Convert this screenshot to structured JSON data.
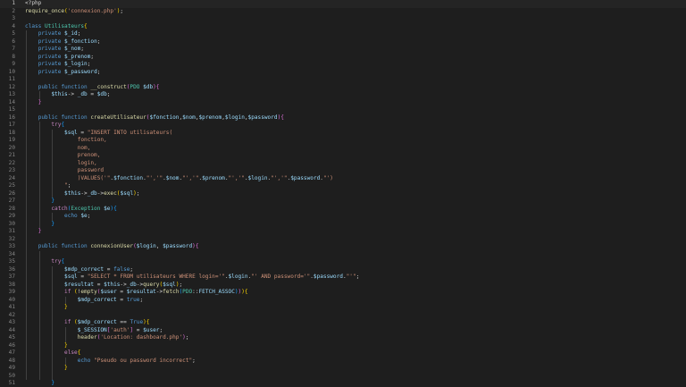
{
  "editor": {
    "lines": [
      {
        "n": "1",
        "tokens": [
          [
            "o",
            "<?php"
          ]
        ]
      },
      {
        "n": "2",
        "tokens": [
          [
            "f",
            "require_once"
          ],
          [
            "y",
            "("
          ],
          [
            "s",
            "'connexion.php'"
          ],
          [
            "y",
            ")"
          ],
          [
            "o",
            ";"
          ]
        ]
      },
      {
        "n": "3",
        "tokens": []
      },
      {
        "n": "4",
        "tokens": [
          [
            "k",
            "class "
          ],
          [
            "t",
            "Utilisateurs"
          ],
          [
            "y",
            "{"
          ]
        ]
      },
      {
        "n": "5",
        "tokens": [
          [
            "o",
            "    "
          ],
          [
            "k",
            "private "
          ],
          [
            "v",
            "$_id"
          ],
          [
            "o",
            ";"
          ]
        ]
      },
      {
        "n": "6",
        "tokens": [
          [
            "o",
            "    "
          ],
          [
            "k",
            "private "
          ],
          [
            "v",
            "$_fonction"
          ],
          [
            "o",
            ";"
          ]
        ]
      },
      {
        "n": "7",
        "tokens": [
          [
            "o",
            "    "
          ],
          [
            "k",
            "private "
          ],
          [
            "v",
            "$_nom"
          ],
          [
            "o",
            ";"
          ]
        ]
      },
      {
        "n": "8",
        "tokens": [
          [
            "o",
            "    "
          ],
          [
            "k",
            "private "
          ],
          [
            "v",
            "$_prenom"
          ],
          [
            "o",
            ";"
          ]
        ]
      },
      {
        "n": "9",
        "tokens": [
          [
            "o",
            "    "
          ],
          [
            "k",
            "private "
          ],
          [
            "v",
            "$_login"
          ],
          [
            "o",
            ";"
          ]
        ]
      },
      {
        "n": "10",
        "tokens": [
          [
            "o",
            "    "
          ],
          [
            "k",
            "private "
          ],
          [
            "v",
            "$_password"
          ],
          [
            "o",
            ";"
          ]
        ]
      },
      {
        "n": "11",
        "tokens": []
      },
      {
        "n": "12",
        "tokens": [
          [
            "o",
            "    "
          ],
          [
            "k",
            "public function "
          ],
          [
            "f",
            "__construct"
          ],
          [
            "p",
            "("
          ],
          [
            "t",
            "PDO "
          ],
          [
            "v",
            "$db"
          ],
          [
            "p",
            ")"
          ],
          [
            "p",
            "{"
          ]
        ]
      },
      {
        "n": "13",
        "tokens": [
          [
            "o",
            "        "
          ],
          [
            "v",
            "$this"
          ],
          [
            "o",
            "-> "
          ],
          [
            "v",
            "_db"
          ],
          [
            "o",
            " = "
          ],
          [
            "v",
            "$db"
          ],
          [
            "o",
            ";"
          ]
        ]
      },
      {
        "n": "14",
        "tokens": [
          [
            "o",
            "    "
          ],
          [
            "p",
            "}"
          ]
        ]
      },
      {
        "n": "15",
        "tokens": []
      },
      {
        "n": "16",
        "tokens": [
          [
            "o",
            "    "
          ],
          [
            "k",
            "public function "
          ],
          [
            "f",
            "createUtilisateur"
          ],
          [
            "p",
            "("
          ],
          [
            "v",
            "$fonction"
          ],
          [
            "o",
            ","
          ],
          [
            "v",
            "$nom"
          ],
          [
            "o",
            ","
          ],
          [
            "v",
            "$prenom"
          ],
          [
            "o",
            ","
          ],
          [
            "v",
            "$login"
          ],
          [
            "o",
            ","
          ],
          [
            "v",
            "$password"
          ],
          [
            "p",
            ")"
          ],
          [
            "p",
            "{"
          ]
        ]
      },
      {
        "n": "17",
        "tokens": [
          [
            "o",
            "        "
          ],
          [
            "c",
            "try"
          ],
          [
            "b",
            "{"
          ]
        ]
      },
      {
        "n": "18",
        "tokens": [
          [
            "o",
            "            "
          ],
          [
            "v",
            "$sql"
          ],
          [
            "o",
            " = "
          ],
          [
            "s",
            "\"INSERT INTO utilisateurs("
          ]
        ]
      },
      {
        "n": "19",
        "tokens": [
          [
            "s",
            "                fonction,"
          ]
        ]
      },
      {
        "n": "20",
        "tokens": [
          [
            "s",
            "                nom,"
          ]
        ]
      },
      {
        "n": "21",
        "tokens": [
          [
            "s",
            "                prenom,"
          ]
        ]
      },
      {
        "n": "22",
        "tokens": [
          [
            "s",
            "                login,"
          ]
        ]
      },
      {
        "n": "23",
        "tokens": [
          [
            "s",
            "                password"
          ]
        ]
      },
      {
        "n": "24",
        "tokens": [
          [
            "s",
            "                )VALUES('\""
          ],
          [
            "o",
            "."
          ],
          [
            "v",
            "$fonction"
          ],
          [
            "o",
            "."
          ],
          [
            "s",
            "\"','\""
          ],
          [
            "o",
            "."
          ],
          [
            "v",
            "$nom"
          ],
          [
            "o",
            "."
          ],
          [
            "s",
            "\"','\""
          ],
          [
            "o",
            "."
          ],
          [
            "v",
            "$prenom"
          ],
          [
            "o",
            "."
          ],
          [
            "s",
            "\"','\""
          ],
          [
            "o",
            "."
          ],
          [
            "v",
            "$login"
          ],
          [
            "o",
            "."
          ],
          [
            "s",
            "\"','\""
          ],
          [
            "o",
            "."
          ],
          [
            "v",
            "$password"
          ],
          [
            "o",
            "."
          ],
          [
            "s",
            "\"')"
          ]
        ]
      },
      {
        "n": "25",
        "tokens": [
          [
            "s",
            "            \""
          ],
          [
            "o",
            ";"
          ]
        ]
      },
      {
        "n": "26",
        "tokens": [
          [
            "o",
            "            "
          ],
          [
            "v",
            "$this"
          ],
          [
            "o",
            "->"
          ],
          [
            "v",
            "_db"
          ],
          [
            "o",
            "->"
          ],
          [
            "f",
            "exec"
          ],
          [
            "y",
            "("
          ],
          [
            "v",
            "$sql"
          ],
          [
            "y",
            ")"
          ],
          [
            "o",
            ";"
          ]
        ]
      },
      {
        "n": "27",
        "tokens": [
          [
            "o",
            "        "
          ],
          [
            "b",
            "}"
          ]
        ]
      },
      {
        "n": "28",
        "tokens": [
          [
            "o",
            "        "
          ],
          [
            "c",
            "catch"
          ],
          [
            "b",
            "("
          ],
          [
            "t",
            "Exception "
          ],
          [
            "v",
            "$e"
          ],
          [
            "b",
            ")"
          ],
          [
            "b",
            "{"
          ]
        ]
      },
      {
        "n": "29",
        "tokens": [
          [
            "o",
            "            "
          ],
          [
            "k",
            "echo "
          ],
          [
            "v",
            "$e"
          ],
          [
            "o",
            ";"
          ]
        ]
      },
      {
        "n": "30",
        "tokens": [
          [
            "o",
            "        "
          ],
          [
            "b",
            "}"
          ]
        ]
      },
      {
        "n": "31",
        "tokens": [
          [
            "o",
            "    "
          ],
          [
            "p",
            "}"
          ]
        ]
      },
      {
        "n": "32",
        "tokens": []
      },
      {
        "n": "33",
        "tokens": [
          [
            "o",
            "    "
          ],
          [
            "k",
            "public function "
          ],
          [
            "f",
            "connexionUser"
          ],
          [
            "p",
            "("
          ],
          [
            "v",
            "$login"
          ],
          [
            "o",
            ", "
          ],
          [
            "v",
            "$password"
          ],
          [
            "p",
            ")"
          ],
          [
            "p",
            "{"
          ]
        ]
      },
      {
        "n": "34",
        "tokens": []
      },
      {
        "n": "35",
        "tokens": [
          [
            "o",
            "        "
          ],
          [
            "c",
            "try"
          ],
          [
            "b",
            "{"
          ]
        ]
      },
      {
        "n": "36",
        "tokens": [
          [
            "o",
            "            "
          ],
          [
            "v",
            "$mdp_correct"
          ],
          [
            "o",
            " = "
          ],
          [
            "k",
            "false"
          ],
          [
            "o",
            ";"
          ]
        ]
      },
      {
        "n": "37",
        "tokens": [
          [
            "o",
            "            "
          ],
          [
            "v",
            "$sql"
          ],
          [
            "o",
            " = "
          ],
          [
            "s",
            "\"SELECT * FROM utilisateurs WHERE login='\""
          ],
          [
            "o",
            "."
          ],
          [
            "v",
            "$login"
          ],
          [
            "o",
            "."
          ],
          [
            "s",
            "\"' AND password='\""
          ],
          [
            "o",
            "."
          ],
          [
            "v",
            "$password"
          ],
          [
            "o",
            "."
          ],
          [
            "s",
            "\"'\""
          ],
          [
            "o",
            ";"
          ]
        ]
      },
      {
        "n": "38",
        "tokens": [
          [
            "o",
            "            "
          ],
          [
            "v",
            "$resultat"
          ],
          [
            "o",
            " = "
          ],
          [
            "v",
            "$this"
          ],
          [
            "o",
            "->"
          ],
          [
            "v",
            "_db"
          ],
          [
            "o",
            "->"
          ],
          [
            "f",
            "query"
          ],
          [
            "y",
            "("
          ],
          [
            "v",
            "$sql"
          ],
          [
            "y",
            ")"
          ],
          [
            "o",
            ";"
          ]
        ]
      },
      {
        "n": "39",
        "tokens": [
          [
            "o",
            "            "
          ],
          [
            "c",
            "if "
          ],
          [
            "y",
            "("
          ],
          [
            "o",
            "!"
          ],
          [
            "f",
            "empty"
          ],
          [
            "p",
            "("
          ],
          [
            "v",
            "$user"
          ],
          [
            "o",
            " = "
          ],
          [
            "v",
            "$resultat"
          ],
          [
            "o",
            "->"
          ],
          [
            "f",
            "fetch"
          ],
          [
            "b",
            "("
          ],
          [
            "t",
            "PDO"
          ],
          [
            "o",
            "::"
          ],
          [
            "v",
            "FETCH_ASSOC"
          ],
          [
            "b",
            ")"
          ],
          [
            "p",
            ")"
          ],
          [
            "y",
            ")"
          ],
          [
            "y",
            "{"
          ]
        ]
      },
      {
        "n": "40",
        "tokens": [
          [
            "o",
            "                "
          ],
          [
            "v",
            "$mdp_correct"
          ],
          [
            "o",
            " = "
          ],
          [
            "k",
            "true"
          ],
          [
            "o",
            ";"
          ]
        ]
      },
      {
        "n": "41",
        "tokens": [
          [
            "o",
            "            "
          ],
          [
            "y",
            "}"
          ]
        ]
      },
      {
        "n": "42",
        "tokens": []
      },
      {
        "n": "43",
        "tokens": [
          [
            "o",
            "            "
          ],
          [
            "c",
            "if "
          ],
          [
            "y",
            "("
          ],
          [
            "v",
            "$mdp_correct"
          ],
          [
            "o",
            " == "
          ],
          [
            "k",
            "True"
          ],
          [
            "y",
            ")"
          ],
          [
            "y",
            "{"
          ]
        ]
      },
      {
        "n": "44",
        "tokens": [
          [
            "o",
            "                "
          ],
          [
            "v",
            "$_SESSION"
          ],
          [
            "p",
            "["
          ],
          [
            "s",
            "'auth'"
          ],
          [
            "p",
            "]"
          ],
          [
            "o",
            " = "
          ],
          [
            "v",
            "$user"
          ],
          [
            "o",
            ";"
          ]
        ]
      },
      {
        "n": "45",
        "tokens": [
          [
            "o",
            "                "
          ],
          [
            "f",
            "header"
          ],
          [
            "p",
            "("
          ],
          [
            "s",
            "'Location: dashboard.php'"
          ],
          [
            "p",
            ")"
          ],
          [
            "o",
            ";"
          ]
        ]
      },
      {
        "n": "46",
        "tokens": [
          [
            "o",
            "            "
          ],
          [
            "y",
            "}"
          ]
        ]
      },
      {
        "n": "47",
        "tokens": [
          [
            "o",
            "            "
          ],
          [
            "c",
            "else"
          ],
          [
            "y",
            "{"
          ]
        ]
      },
      {
        "n": "48",
        "tokens": [
          [
            "o",
            "                "
          ],
          [
            "k",
            "echo "
          ],
          [
            "s",
            "\"Pseudo ou password incorrect\""
          ],
          [
            "o",
            ";"
          ]
        ]
      },
      {
        "n": "49",
        "tokens": [
          [
            "o",
            "            "
          ],
          [
            "y",
            "}"
          ]
        ]
      },
      {
        "n": "50",
        "tokens": []
      },
      {
        "n": "51",
        "tokens": [
          [
            "o",
            "        "
          ],
          [
            "b",
            "}"
          ]
        ]
      }
    ],
    "colors": {
      "background": "#1e1e1e",
      "line_number": "#858585",
      "keyword": "#569cd6",
      "control": "#c586c0",
      "function": "#dcdcaa",
      "string": "#ce9178",
      "variable": "#9cdcfe",
      "type": "#4ec9b0"
    }
  }
}
